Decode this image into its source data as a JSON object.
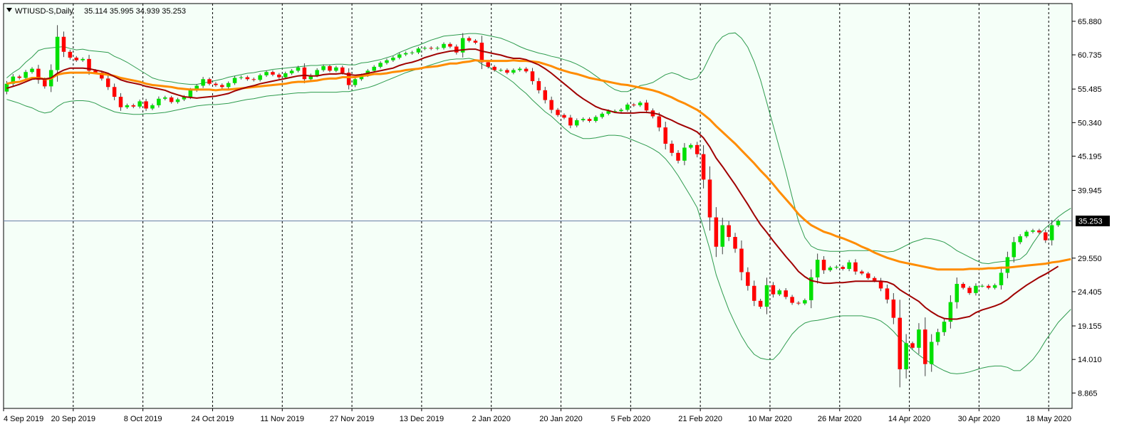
{
  "chart_data": {
    "type": "candlestick",
    "symbol": "WTIUSD-S,Daily",
    "ohlc_label": "35.114 35.995 34.939 35.253",
    "current_price": 35.253,
    "current_price_label": "35.253",
    "y_ticks": [
      "65.880",
      "60.735",
      "55.485",
      "50.340",
      "45.195",
      "39.945",
      "29.550",
      "24.405",
      "19.155",
      "14.010",
      "8.865"
    ],
    "x_ticks": [
      "4 Sep 2019",
      "20 Sep 2019",
      "8 Oct 2019",
      "24 Oct 2019",
      "11 Nov 2019",
      "27 Nov 2019",
      "13 Dec 2019",
      "2 Jan 2020",
      "20 Jan 2020",
      "5 Feb 2020",
      "21 Feb 2020",
      "10 Mar 2020",
      "26 Mar 2020",
      "14 Apr 2020",
      "30 Apr 2020",
      "18 May 2020"
    ],
    "ylim": [
      6.5,
      68.6
    ],
    "grid": "vertical dashed period separators",
    "colors": {
      "background": "#f5fff8",
      "bull": "#00e000",
      "bear": "#ff0000",
      "wick": "#404040",
      "bollinger": "#2e9b4e",
      "ma_slow": "#ff8c00",
      "ma_fast": "#a00000",
      "price_line": "#6b7fa8",
      "separator": "#000000"
    },
    "close": [
      56.3,
      57.4,
      57.2,
      58.1,
      58.6,
      56.9,
      55.9,
      58.4,
      63.5,
      61.2,
      60.3,
      59.9,
      60.1,
      58.3,
      58.0,
      57.1,
      55.8,
      54.3,
      52.7,
      53.0,
      52.8,
      53.6,
      52.5,
      53.0,
      54.0,
      54.2,
      53.5,
      53.9,
      54.3,
      55.3,
      56.0,
      57.0,
      56.3,
      56.1,
      55.8,
      56.4,
      57.2,
      57.3,
      57.0,
      56.9,
      57.6,
      58.1,
      57.7,
      57.3,
      57.9,
      58.3,
      58.8,
      57.0,
      57.6,
      58.4,
      59.0,
      58.3,
      58.8,
      58.0,
      56.1,
      57.0,
      57.6,
      58.3,
      58.9,
      59.5,
      59.9,
      60.3,
      60.8,
      61.0,
      61.1,
      61.7,
      61.8,
      61.7,
      61.8,
      62.4,
      62.0,
      61.1,
      63.3,
      62.9,
      62.6,
      59.6,
      58.9,
      58.4,
      58.4,
      58.0,
      58.4,
      58.6,
      58.2,
      56.7,
      55.3,
      53.8,
      52.3,
      51.5,
      51.1,
      49.9,
      50.7,
      50.9,
      50.6,
      51.2,
      51.7,
      52.1,
      52.1,
      52.3,
      53.1,
      53.0,
      53.4,
      52.2,
      51.3,
      49.6,
      47.1,
      45.7,
      44.5,
      46.5,
      46.9,
      45.5,
      41.6,
      35.8,
      31.3,
      34.6,
      32.8,
      31.0,
      27.4,
      25.3,
      23.0,
      22.1,
      25.4,
      24.0,
      24.6,
      23.6,
      22.7,
      22.6,
      23.1,
      26.6,
      29.3,
      27.7,
      28.1,
      28.2,
      27.9,
      28.9,
      27.5,
      27.2,
      26.5,
      26.1,
      24.9,
      23.2,
      20.4,
      12.5,
      16.5,
      15.8,
      18.6,
      13.3,
      16.7,
      18.2,
      19.8,
      22.8,
      25.6,
      25.0,
      24.2,
      25.3,
      25.3,
      25.0,
      25.4,
      27.3,
      29.7,
      32.0,
      32.9,
      33.6,
      33.8,
      33.5,
      32.3,
      34.6,
      35.25
    ],
    "slow_ma": [
      56.3,
      56.5,
      56.6,
      56.9,
      57.2,
      57.2,
      57.0,
      57.1,
      57.7,
      57.9,
      58.0,
      58.0,
      58.0,
      58.0,
      57.9,
      57.8,
      57.7,
      57.5,
      57.2,
      57.0,
      56.8,
      56.6,
      56.3,
      56.1,
      56.0,
      55.9,
      55.8,
      55.6,
      55.5,
      55.4,
      55.4,
      55.4,
      55.4,
      55.3,
      55.4,
      55.4,
      55.5,
      55.6,
      55.7,
      55.8,
      55.9,
      56.0,
      56.1,
      56.2,
      56.3,
      56.5,
      56.6,
      56.6,
      56.7,
      56.8,
      57.0,
      57.1,
      57.1,
      57.3,
      57.3,
      57.3,
      57.5,
      57.6,
      57.8,
      57.8,
      57.9,
      58.1,
      58.2,
      58.4,
      58.5,
      58.6,
      58.8,
      58.9,
      59.0,
      59.2,
      59.4,
      59.4,
      59.6,
      59.7,
      59.9,
      59.8,
      59.8,
      59.8,
      59.8,
      59.8,
      59.9,
      59.8,
      59.8,
      59.7,
      59.6,
      59.3,
      59.0,
      58.6,
      58.3,
      58.0,
      57.8,
      57.5,
      57.2,
      57.0,
      56.8,
      56.6,
      56.4,
      56.2,
      56.1,
      55.9,
      55.7,
      55.5,
      55.3,
      55.0,
      54.6,
      54.2,
      53.7,
      53.3,
      52.8,
      52.3,
      51.6,
      50.8,
      49.8,
      48.9,
      48.0,
      47.1,
      46.1,
      45.1,
      44.1,
      43.0,
      42.0,
      40.9,
      39.7,
      38.6,
      37.5,
      36.3,
      35.4,
      34.6,
      34.1,
      33.6,
      33.3,
      32.9,
      32.6,
      32.2,
      31.8,
      31.3,
      30.9,
      30.4,
      30.0,
      29.6,
      29.3,
      29.0,
      28.8,
      28.6,
      28.4,
      28.2,
      28.0,
      27.8,
      27.8,
      27.8,
      27.8,
      27.8,
      27.9,
      27.9,
      27.9,
      28.0,
      28.0,
      28.1,
      28.1,
      28.2,
      28.3,
      28.4,
      28.5,
      28.6,
      28.7,
      28.9,
      29.0,
      29.2,
      29.4
    ],
    "fast_ma": [
      55.6,
      55.9,
      56.2,
      56.6,
      57.0,
      57.1,
      57.0,
      57.2,
      57.9,
      58.4,
      58.7,
      58.7,
      58.7,
      58.6,
      58.4,
      58.2,
      57.9,
      57.4,
      56.9,
      56.6,
      56.4,
      56.2,
      55.9,
      55.7,
      55.5,
      55.3,
      54.9,
      54.6,
      54.3,
      54.2,
      54.1,
      54.2,
      54.3,
      54.4,
      54.6,
      54.8,
      55.2,
      55.5,
      55.8,
      56.0,
      56.3,
      56.5,
      56.7,
      56.9,
      57.1,
      57.3,
      57.5,
      57.6,
      57.5,
      57.5,
      57.7,
      57.8,
      57.8,
      57.9,
      57.7,
      57.6,
      57.7,
      57.9,
      58.1,
      58.3,
      58.5,
      58.7,
      59.1,
      59.4,
      59.6,
      59.9,
      60.3,
      60.6,
      60.9,
      61.1,
      61.3,
      61.4,
      61.5,
      61.6,
      61.6,
      61.3,
      61.1,
      60.9,
      60.7,
      60.4,
      60.2,
      60.2,
      60.0,
      59.6,
      59.2,
      58.6,
      57.9,
      57.1,
      56.3,
      55.5,
      54.7,
      54.0,
      53.4,
      52.8,
      52.4,
      52.2,
      51.9,
      51.8,
      51.8,
      51.8,
      51.9,
      51.9,
      51.8,
      51.6,
      51.1,
      50.7,
      50.2,
      49.8,
      49.4,
      48.9,
      48.0,
      46.6,
      44.9,
      43.6,
      42.2,
      40.8,
      39.3,
      37.8,
      36.2,
      34.7,
      33.5,
      32.2,
      31.0,
      29.8,
      28.7,
      27.5,
      26.7,
      26.1,
      25.9,
      25.7,
      25.7,
      25.8,
      25.8,
      25.9,
      26.0,
      26.0,
      26.0,
      26.0,
      26.0,
      25.9,
      25.5,
      24.7,
      24.1,
      23.5,
      22.9,
      22.0,
      21.3,
      20.7,
      20.3,
      20.2,
      20.2,
      20.4,
      20.6,
      21.2,
      21.6,
      21.9,
      22.2,
      22.6,
      23.2,
      24.0,
      24.7,
      25.4,
      26.0,
      26.6,
      27.1,
      27.7,
      28.3
    ],
    "upper_band": [
      57.2,
      58.0,
      58.6,
      59.6,
      60.4,
      61.4,
      61.7,
      61.8,
      61.9,
      62.0,
      61.7,
      61.5,
      61.6,
      61.4,
      61.3,
      61.2,
      61.1,
      60.5,
      60.1,
      59.6,
      59.0,
      58.4,
      57.8,
      57.2,
      56.9,
      56.7,
      56.6,
      56.4,
      56.3,
      56.2,
      56.2,
      56.4,
      56.6,
      56.8,
      57.0,
      57.3,
      57.5,
      57.7,
      57.9,
      58.0,
      58.2,
      58.3,
      58.5,
      58.6,
      58.7,
      58.8,
      58.9,
      59.0,
      59.1,
      59.1,
      59.2,
      59.2,
      59.3,
      59.3,
      59.2,
      59.2,
      59.5,
      59.6,
      59.8,
      60.0,
      60.3,
      60.6,
      61.1,
      61.5,
      61.9,
      62.2,
      62.6,
      63.0,
      63.3,
      63.6,
      63.7,
      63.8,
      63.9,
      64.0,
      64.0,
      63.9,
      63.7,
      63.5,
      63.3,
      62.9,
      62.5,
      62.0,
      61.6,
      61.3,
      61.0,
      60.8,
      60.5,
      60.3,
      60.0,
      59.7,
      59.3,
      58.8,
      58.2,
      57.5,
      56.8,
      56.0,
      55.4,
      55.1,
      55.1,
      55.5,
      56.0,
      56.2,
      56.5,
      57.1,
      57.7,
      58.0,
      57.7,
      57.2,
      56.9,
      57.2,
      58.5,
      60.5,
      62.4,
      63.5,
      64.0,
      64.1,
      63.3,
      61.9,
      59.7,
      56.9,
      53.4,
      49.9,
      46.4,
      42.8,
      38.9,
      35.2,
      32.7,
      31.4,
      30.9,
      30.7,
      30.6,
      30.6,
      30.6,
      30.7,
      30.7,
      30.7,
      30.7,
      30.7,
      30.6,
      30.5,
      30.6,
      31.0,
      31.5,
      32.0,
      32.3,
      32.6,
      32.5,
      32.3,
      32.0,
      31.4,
      30.7,
      30.2,
      29.7,
      29.2,
      28.8,
      28.7,
      28.9,
      29.0,
      29.1,
      29.2,
      29.4,
      30.2,
      31.8,
      33.2,
      34.2,
      35.0,
      35.9,
      36.6,
      37.2
    ],
    "lower_band": [
      53.9,
      53.6,
      53.3,
      52.9,
      52.6,
      52.1,
      51.8,
      52.0,
      52.8,
      53.4,
      53.6,
      53.7,
      53.7,
      53.6,
      53.3,
      52.8,
      52.4,
      52.0,
      51.8,
      51.7,
      51.6,
      51.6,
      51.7,
      51.7,
      51.8,
      51.9,
      52.1,
      52.3,
      52.5,
      52.7,
      52.9,
      53.0,
      53.1,
      53.1,
      53.2,
      53.3,
      53.5,
      53.7,
      53.9,
      54.0,
      54.2,
      54.4,
      54.5,
      54.6,
      54.7,
      54.8,
      54.9,
      54.9,
      55.0,
      55.0,
      55.0,
      55.0,
      55.0,
      55.1,
      55.1,
      55.3,
      55.5,
      55.7,
      56.0,
      56.4,
      56.8,
      57.2,
      57.6,
      58.0,
      58.3,
      58.6,
      58.9,
      59.2,
      59.5,
      59.8,
      60.0,
      60.1,
      60.1,
      60.2,
      60.0,
      59.3,
      58.9,
      58.4,
      57.8,
      57.2,
      56.5,
      55.6,
      54.8,
      53.8,
      52.9,
      52.0,
      51.3,
      50.4,
      49.5,
      48.7,
      48.3,
      47.9,
      47.9,
      48.0,
      48.2,
      48.4,
      48.4,
      48.3,
      48.0,
      47.6,
      47.2,
      46.8,
      46.3,
      45.7,
      44.8,
      43.6,
      42.2,
      40.6,
      39.0,
      37.3,
      34.2,
      30.9,
      27.0,
      24.2,
      21.6,
      19.5,
      17.6,
      16.0,
      14.8,
      14.2,
      14.0,
      14.0,
      15.0,
      16.5,
      17.9,
      18.9,
      19.6,
      19.9,
      20.0,
      20.2,
      20.4,
      20.6,
      20.7,
      20.7,
      20.7,
      20.7,
      20.5,
      20.3,
      19.9,
      19.2,
      18.3,
      17.2,
      16.4,
      15.5,
      14.7,
      14.0,
      13.4,
      12.8,
      12.3,
      11.9,
      11.8,
      11.9,
      12.1,
      12.4,
      12.7,
      12.9,
      13.0,
      13.0,
      12.8,
      12.3,
      12.3,
      13.1,
      14.0,
      15.3,
      16.9,
      18.3,
      19.7,
      20.7,
      21.7
    ]
  }
}
